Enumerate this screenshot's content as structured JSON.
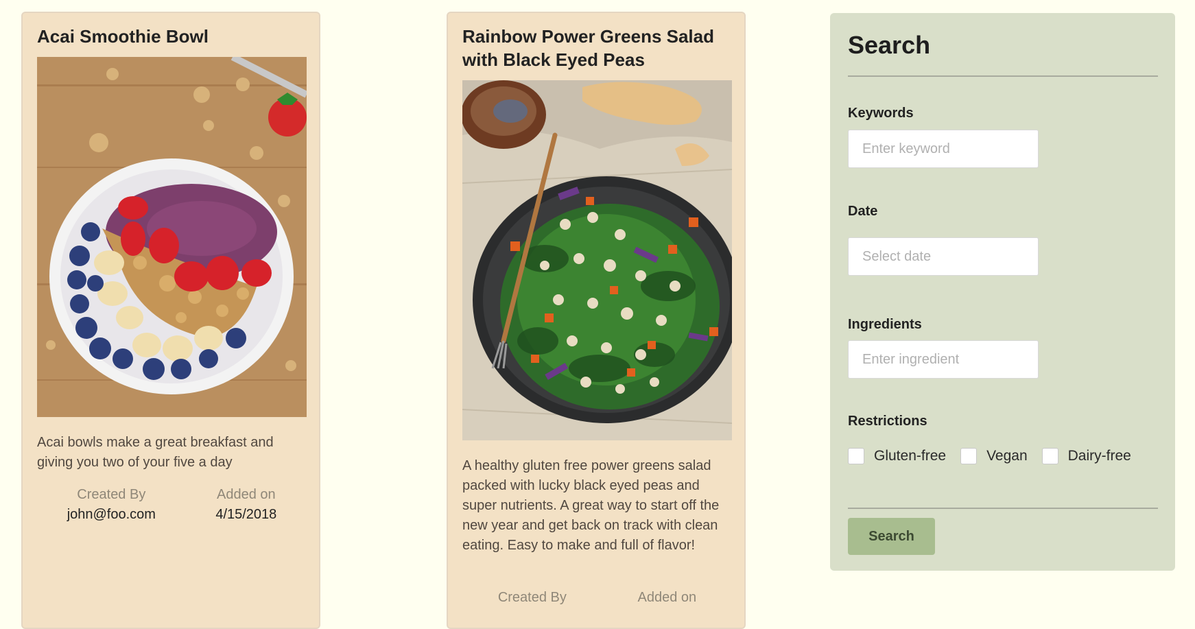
{
  "recipes": [
    {
      "title": "Acai Smoothie Bowl",
      "image_name": "acai-bowl-photo",
      "description": "Acai bowls make a great breakfast and giving you two of your five a day",
      "created_by_label": "Created By",
      "created_by": "john@foo.com",
      "added_on_label": "Added on",
      "added_on": "4/15/2018"
    },
    {
      "title": "Rainbow Power Greens Salad with Black Eyed Peas",
      "image_name": "greens-salad-photo",
      "description": "A healthy gluten free power greens salad packed with lucky black eyed peas and super nutrients. A great way to start off the new year and get back on track with clean eating. Easy to make and full of flavor!",
      "created_by_label": "Created By",
      "added_on_label": "Added on"
    }
  ],
  "search": {
    "title": "Search",
    "keywords_label": "Keywords",
    "keywords_placeholder": "Enter keyword",
    "date_label": "Date",
    "date_placeholder": "Select date",
    "ingredients_label": "Ingredients",
    "ingredients_placeholder": "Enter ingredient",
    "restrictions_label": "Restrictions",
    "restrictions": [
      {
        "label": "Gluten-free",
        "checked": false
      },
      {
        "label": "Vegan",
        "checked": false
      },
      {
        "label": "Dairy-free",
        "checked": false
      }
    ],
    "button_label": "Search"
  },
  "colors": {
    "page_background": "#fffff0",
    "card_background": "#f3e1c5",
    "search_panel_background": "#d9dfc9",
    "search_button": "#a8bd8f"
  }
}
